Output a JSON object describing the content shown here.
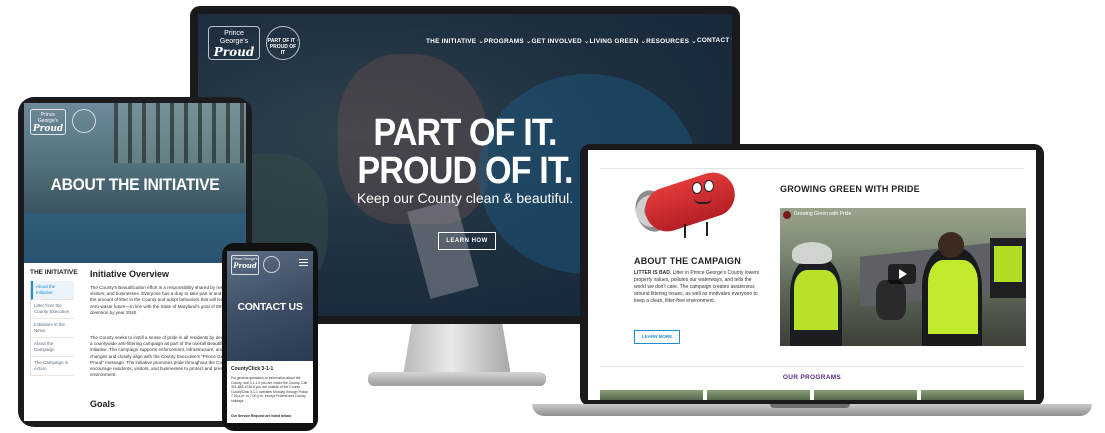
{
  "desktop": {
    "logo": {
      "line1": "Prince",
      "line2": "George's",
      "script": "Proud"
    },
    "badge": "PART OF IT · PROUD OF IT",
    "nav": [
      "THE INITIATIVE ⌄",
      "PROGRAMS ⌄",
      "GET INVOLVED ⌄",
      "LIVING GREEN ⌄",
      "RESOURCES ⌄",
      "CONTACT US"
    ],
    "hero_line1": "PART OF IT.",
    "hero_line2": "PROUD OF IT.",
    "hero_sub": "Keep our County clean & beautiful.",
    "cta": "LEARN HOW"
  },
  "tablet": {
    "logo": {
      "line1": "Prince",
      "line2": "George's",
      "script": "Proud"
    },
    "title": "ABOUT THE INITIATIVE",
    "sidebar_heading": "THE INITIATIVE",
    "sidebar_items": [
      {
        "label": "About the Initiative",
        "active": true
      },
      {
        "label": "Litter from the County Executive",
        "active": false
      },
      {
        "label": "Initiatives in the News",
        "active": false
      },
      {
        "label": "About the Campaign",
        "active": false
      },
      {
        "label": "The Campaign in Action",
        "active": false
      }
    ],
    "section_title": "Initiative Overview",
    "para1": "The County's Beautification effort is a responsibility shared by residents, visitors, and businesses. Everyone has a duty to take part in and reduce the amount of litter in the County and adopt behaviors that will lead to a zero-waste future—in line with the State of Maryland's goal of 85% waste diversion by year 2040.",
    "para2": "The County seeks to instill a sense of pride in all residents by developing a countywide anti-littering campaign as part of the overall Beautification initiative. The campaign supports enforcement, infrastructure, and policy changes and closely align with the County Executive's \"Prince George's Proud\" message. The initiative promotes pride throughout the County and encourage residents, visitors, and businesses to protect and preserve the environment.",
    "goals": "Goals"
  },
  "phone": {
    "logo": {
      "line1": "Prince George's",
      "script": "Proud"
    },
    "title": "CONTACT US",
    "heading": "CountyClick 3-1-1",
    "para": "For general questions or information about the County, dial 3-1-1 if you are inside the County. Call 301-883-4748 if you are outside of the County. CountyClick 3-1-1 operates Monday through Friday 7:00 a.m. to 7:00 p.m. except Federal and County holidays.",
    "footer": "Our Service Request are listed below."
  },
  "laptop": {
    "campaign_heading": "ABOUT THE CAMPAIGN",
    "campaign_lead": "LITTER IS BAD.",
    "campaign_text": " Litter in Prince George's County lowers property values, pollutes our waterways, and tells the world we don't care. The campaign creates awareness around littering issues, as well as motivates everyone to keep a clean, litter-free environment.",
    "learn_more": "LEARN MORE",
    "video_heading": "GROWING GREEN WITH PRIDE",
    "video_title": "Growing Green with Pride",
    "programs_heading": "OUR PROGRAMS"
  },
  "colors": {
    "accent_blue": "#1f8fd0",
    "programs_purple": "#5b2a86",
    "vest_green": "#b8e22a"
  }
}
